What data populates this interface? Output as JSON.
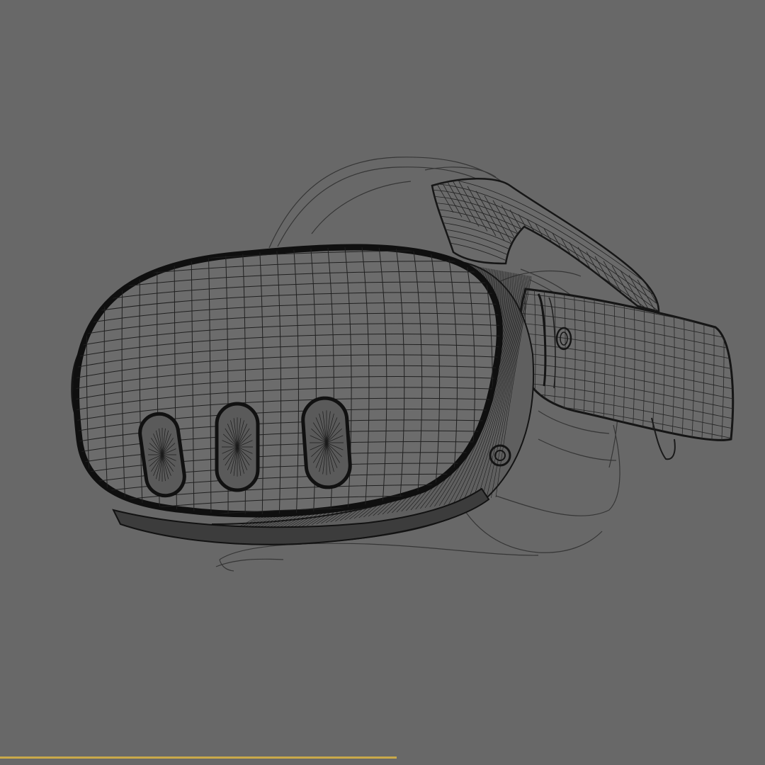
{
  "viewport": {
    "background": "#686868",
    "wire_color": "#1c1c1c",
    "accent_line": "#c9a94a"
  },
  "model": {
    "type": "VR headset wireframe",
    "icons": [
      "front-panel",
      "tracking-camera",
      "head-strap",
      "side-strap",
      "facial-interface"
    ]
  }
}
